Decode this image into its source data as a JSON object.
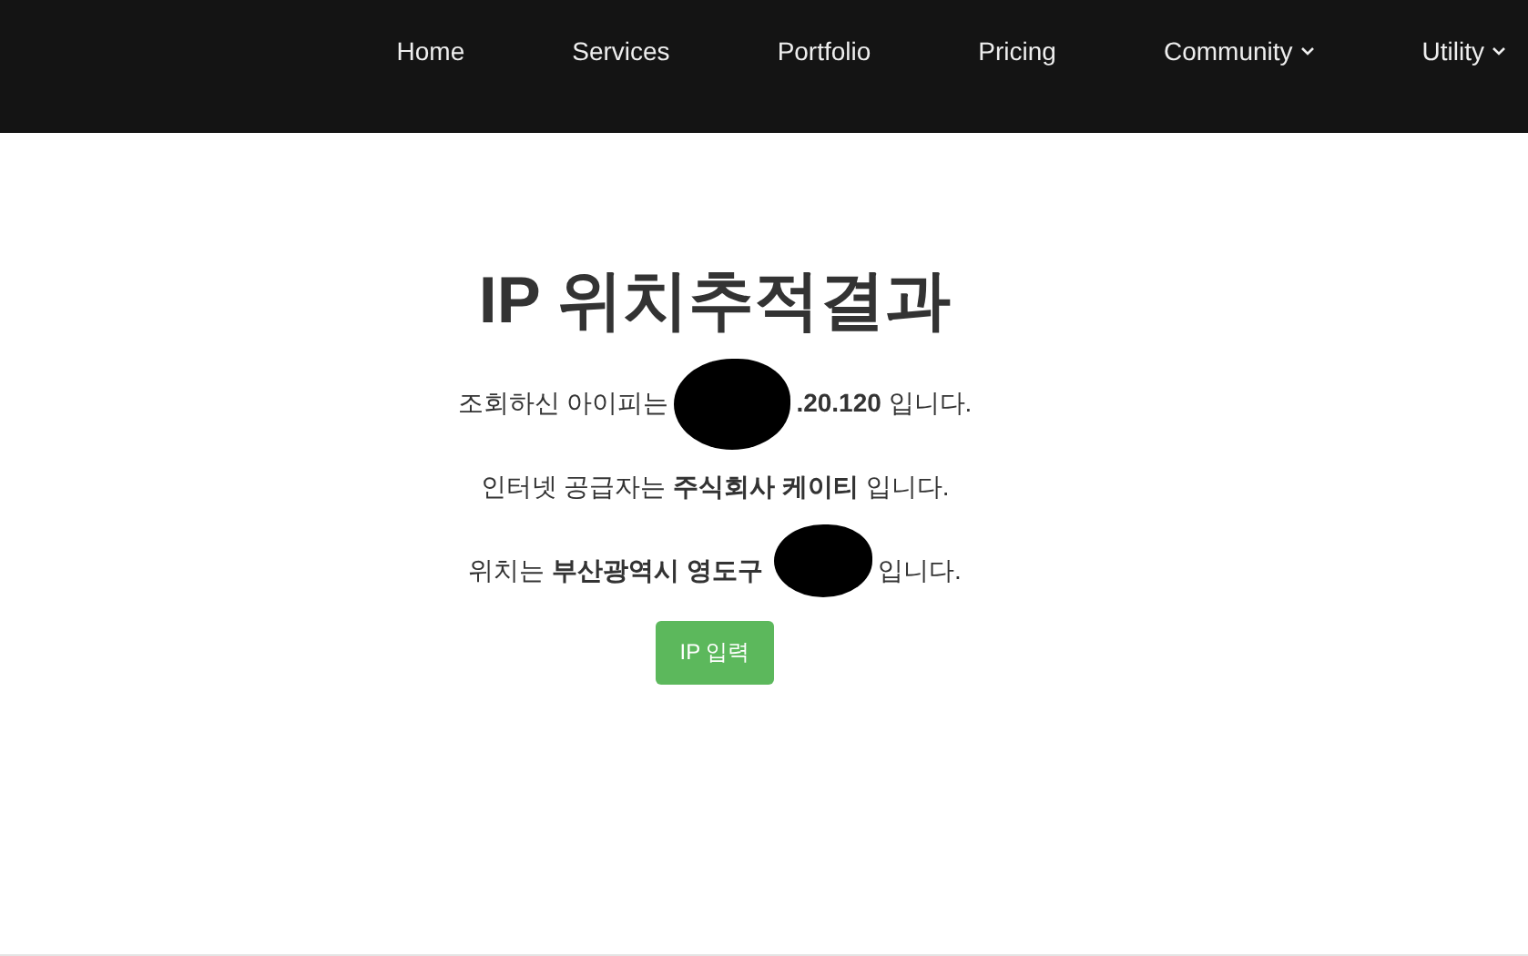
{
  "nav": {
    "items": [
      {
        "label": "Home",
        "dropdown": false
      },
      {
        "label": "Services",
        "dropdown": false
      },
      {
        "label": "Portfolio",
        "dropdown": false
      },
      {
        "label": "Pricing",
        "dropdown": false
      },
      {
        "label": "Community",
        "dropdown": true
      },
      {
        "label": "Utility",
        "dropdown": true
      }
    ]
  },
  "result": {
    "title": "IP 위치추적결과",
    "lines": [
      {
        "before": "조회하신 아이피는",
        "redacted": true,
        "after": "**.20.120** 입니다."
      },
      {
        "before": "인터넷 공급자는 **주식회사 케이티** 입니다.",
        "redacted": false
      },
      {
        "before": "위치는 **부산광역시 영도구**",
        "redacted": true,
        "after": "입니다."
      }
    ],
    "button": "IP 입력"
  }
}
